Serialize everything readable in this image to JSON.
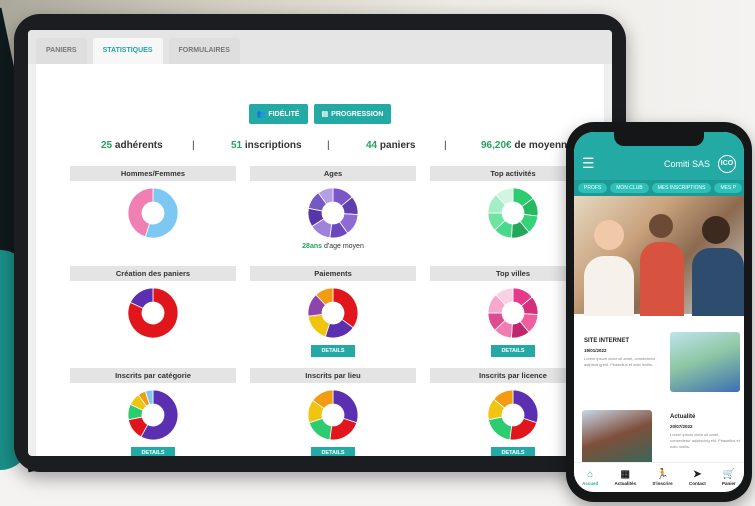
{
  "tablet": {
    "tabs": [
      {
        "label": "PANIERS"
      },
      {
        "label": "STATISTIQUES"
      },
      {
        "label": "FORMULAIRES"
      }
    ],
    "buttons": {
      "fidelite": "FIDÉLITÉ",
      "progression": "PROGRESSION"
    },
    "stats": {
      "adherents_num": "25",
      "adherents_label": "adhérents",
      "inscriptions_num": "51",
      "inscriptions_label": "inscriptions",
      "paniers_num": "44",
      "paniers_label": "paniers",
      "moyenne_num": "96,20€",
      "moyenne_label": "de moyenne",
      "separator": "|"
    },
    "panels": {
      "hommes_femmes": "Hommes/Femmes",
      "ages": "Ages",
      "ages_caption_num": "28ans",
      "ages_caption_text": "d'age moyen",
      "top_activites": "Top activités",
      "creation_paniers": "Création des paniers",
      "paiements": "Paiements",
      "top_villes": "Top villes",
      "inscrits_categorie": "Inscrits par catégorie",
      "inscrits_lieu": "Inscrits par lieu",
      "inscrits_licence": "Inscrits par licence",
      "details_label": "DETAILS"
    },
    "colors": {
      "accent": "#23aaa4",
      "green_number": "#23a45e"
    }
  },
  "phone": {
    "brand": "Comiti SAS",
    "logo_text": "ICO",
    "pills": [
      "PROFS",
      "MON CLUB",
      "MES INSCRIPTIONS",
      "MES P"
    ],
    "news": [
      {
        "title": "SITE INTERNET",
        "date": "19/01/2022",
        "text": "Lorem ipsum dolor sit amet, consectetur adipiscing elit. Phasellus et odio mollis."
      },
      {
        "title": "Actualité",
        "date": "20/07/2022",
        "text": "Lorem ipsum dolor sit amet, consectetur adipiscing elit. Phasellus et odio mollis."
      }
    ],
    "bottom_nav": [
      {
        "label": "Accueil",
        "icon": "home-icon"
      },
      {
        "label": "Actualités",
        "icon": "news-icon"
      },
      {
        "label": "S'inscrire",
        "icon": "run-icon"
      },
      {
        "label": "Contact",
        "icon": "send-icon"
      },
      {
        "label": "Panier",
        "icon": "cart-icon"
      }
    ]
  },
  "donuts": {
    "hommes_femmes": [
      {
        "v": 55,
        "c": "#7cc8f2"
      },
      {
        "v": 45,
        "c": "#f07fb3"
      }
    ],
    "ages": [
      {
        "v": 14,
        "c": "#7b56c8"
      },
      {
        "v": 12,
        "c": "#5f3fb0"
      },
      {
        "v": 14,
        "c": "#8d6ad6"
      },
      {
        "v": 12,
        "c": "#6a49bf"
      },
      {
        "v": 14,
        "c": "#9f82de"
      },
      {
        "v": 12,
        "c": "#5836a8"
      },
      {
        "v": 12,
        "c": "#7458c4"
      },
      {
        "v": 10,
        "c": "#b49ee6"
      }
    ],
    "top_activites": [
      {
        "v": 15,
        "c": "#2ecc71"
      },
      {
        "v": 12,
        "c": "#27b862"
      },
      {
        "v": 12,
        "c": "#34d27a"
      },
      {
        "v": 12,
        "c": "#22a858"
      },
      {
        "v": 12,
        "c": "#48d98b"
      },
      {
        "v": 12,
        "c": "#6fe3a4"
      },
      {
        "v": 13,
        "c": "#a5edc6"
      },
      {
        "v": 12,
        "c": "#d2f5e2"
      }
    ],
    "creation_paniers": [
      {
        "v": 82,
        "c": "#e0161c"
      },
      {
        "v": 18,
        "c": "#5a2fb0"
      }
    ],
    "paiements": [
      {
        "v": 35,
        "c": "#e0161c"
      },
      {
        "v": 20,
        "c": "#5a2fb0"
      },
      {
        "v": 18,
        "c": "#f1c40f"
      },
      {
        "v": 15,
        "c": "#8e44ad"
      },
      {
        "v": 12,
        "c": "#f39c12"
      }
    ],
    "top_villes": [
      {
        "v": 14,
        "c": "#e8388a"
      },
      {
        "v": 12,
        "c": "#d42f7a"
      },
      {
        "v": 13,
        "c": "#f05ea0"
      },
      {
        "v": 12,
        "c": "#c0266d"
      },
      {
        "v": 12,
        "c": "#f27cb2"
      },
      {
        "v": 12,
        "c": "#e04a8e"
      },
      {
        "v": 13,
        "c": "#f7a8cd"
      },
      {
        "v": 12,
        "c": "#fbd0e4"
      }
    ],
    "inscrits_categorie": [
      {
        "v": 58,
        "c": "#5a2fb0"
      },
      {
        "v": 14,
        "c": "#e0161c"
      },
      {
        "v": 10,
        "c": "#2ecc71"
      },
      {
        "v": 8,
        "c": "#f1c40f"
      },
      {
        "v": 5,
        "c": "#f39c12"
      },
      {
        "v": 5,
        "c": "#7cc8f2"
      }
    ],
    "inscrits_lieu": [
      {
        "v": 30,
        "c": "#5a2fb0"
      },
      {
        "v": 22,
        "c": "#e0161c"
      },
      {
        "v": 18,
        "c": "#2ecc71"
      },
      {
        "v": 15,
        "c": "#f1c40f"
      },
      {
        "v": 15,
        "c": "#f39c12"
      }
    ],
    "inscrits_licence": [
      {
        "v": 30,
        "c": "#5a2fb0"
      },
      {
        "v": 22,
        "c": "#e0161c"
      },
      {
        "v": 20,
        "c": "#2ecc71"
      },
      {
        "v": 14,
        "c": "#f1c40f"
      },
      {
        "v": 14,
        "c": "#f39c12"
      }
    ]
  }
}
